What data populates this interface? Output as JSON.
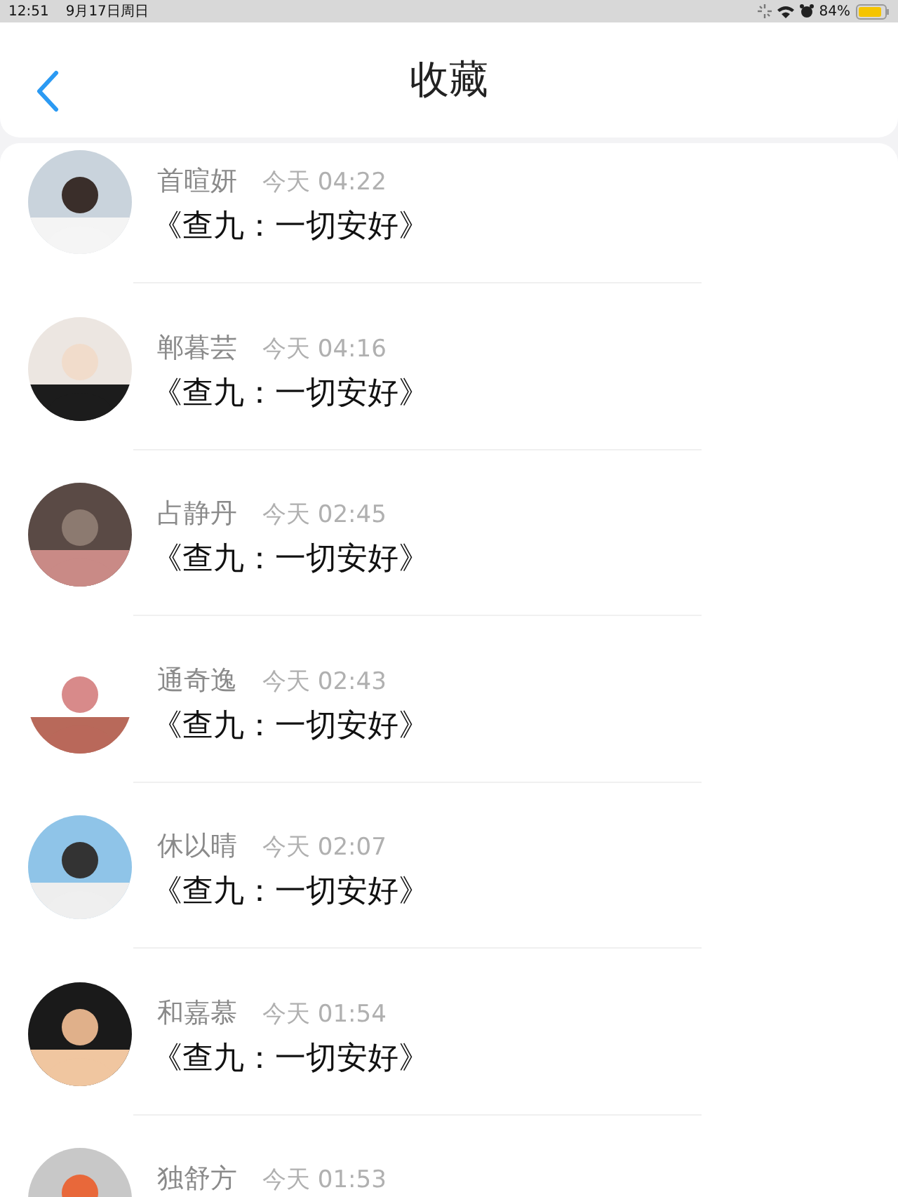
{
  "status_bar": {
    "time": "12:51",
    "date": "9月17日周日",
    "battery": "84%"
  },
  "header": {
    "title": "收藏"
  },
  "items": [
    {
      "name": "首暄妍",
      "time": "今天 04:22",
      "title": "《查九：一切安好》"
    },
    {
      "name": "郸暮芸",
      "time": "今天 04:16",
      "title": "《查九：一切安好》"
    },
    {
      "name": "占静丹",
      "time": "今天 02:45",
      "title": "《查九：一切安好》"
    },
    {
      "name": "通奇逸",
      "time": "今天 02:43",
      "title": "《查九：一切安好》"
    },
    {
      "name": "休以晴",
      "time": "今天 02:07",
      "title": "《查九：一切安好》"
    },
    {
      "name": "和嘉慕",
      "time": "今天 01:54",
      "title": "《查九：一切安好》"
    },
    {
      "name": "独舒方",
      "time": "今天 01:53"
    }
  ]
}
